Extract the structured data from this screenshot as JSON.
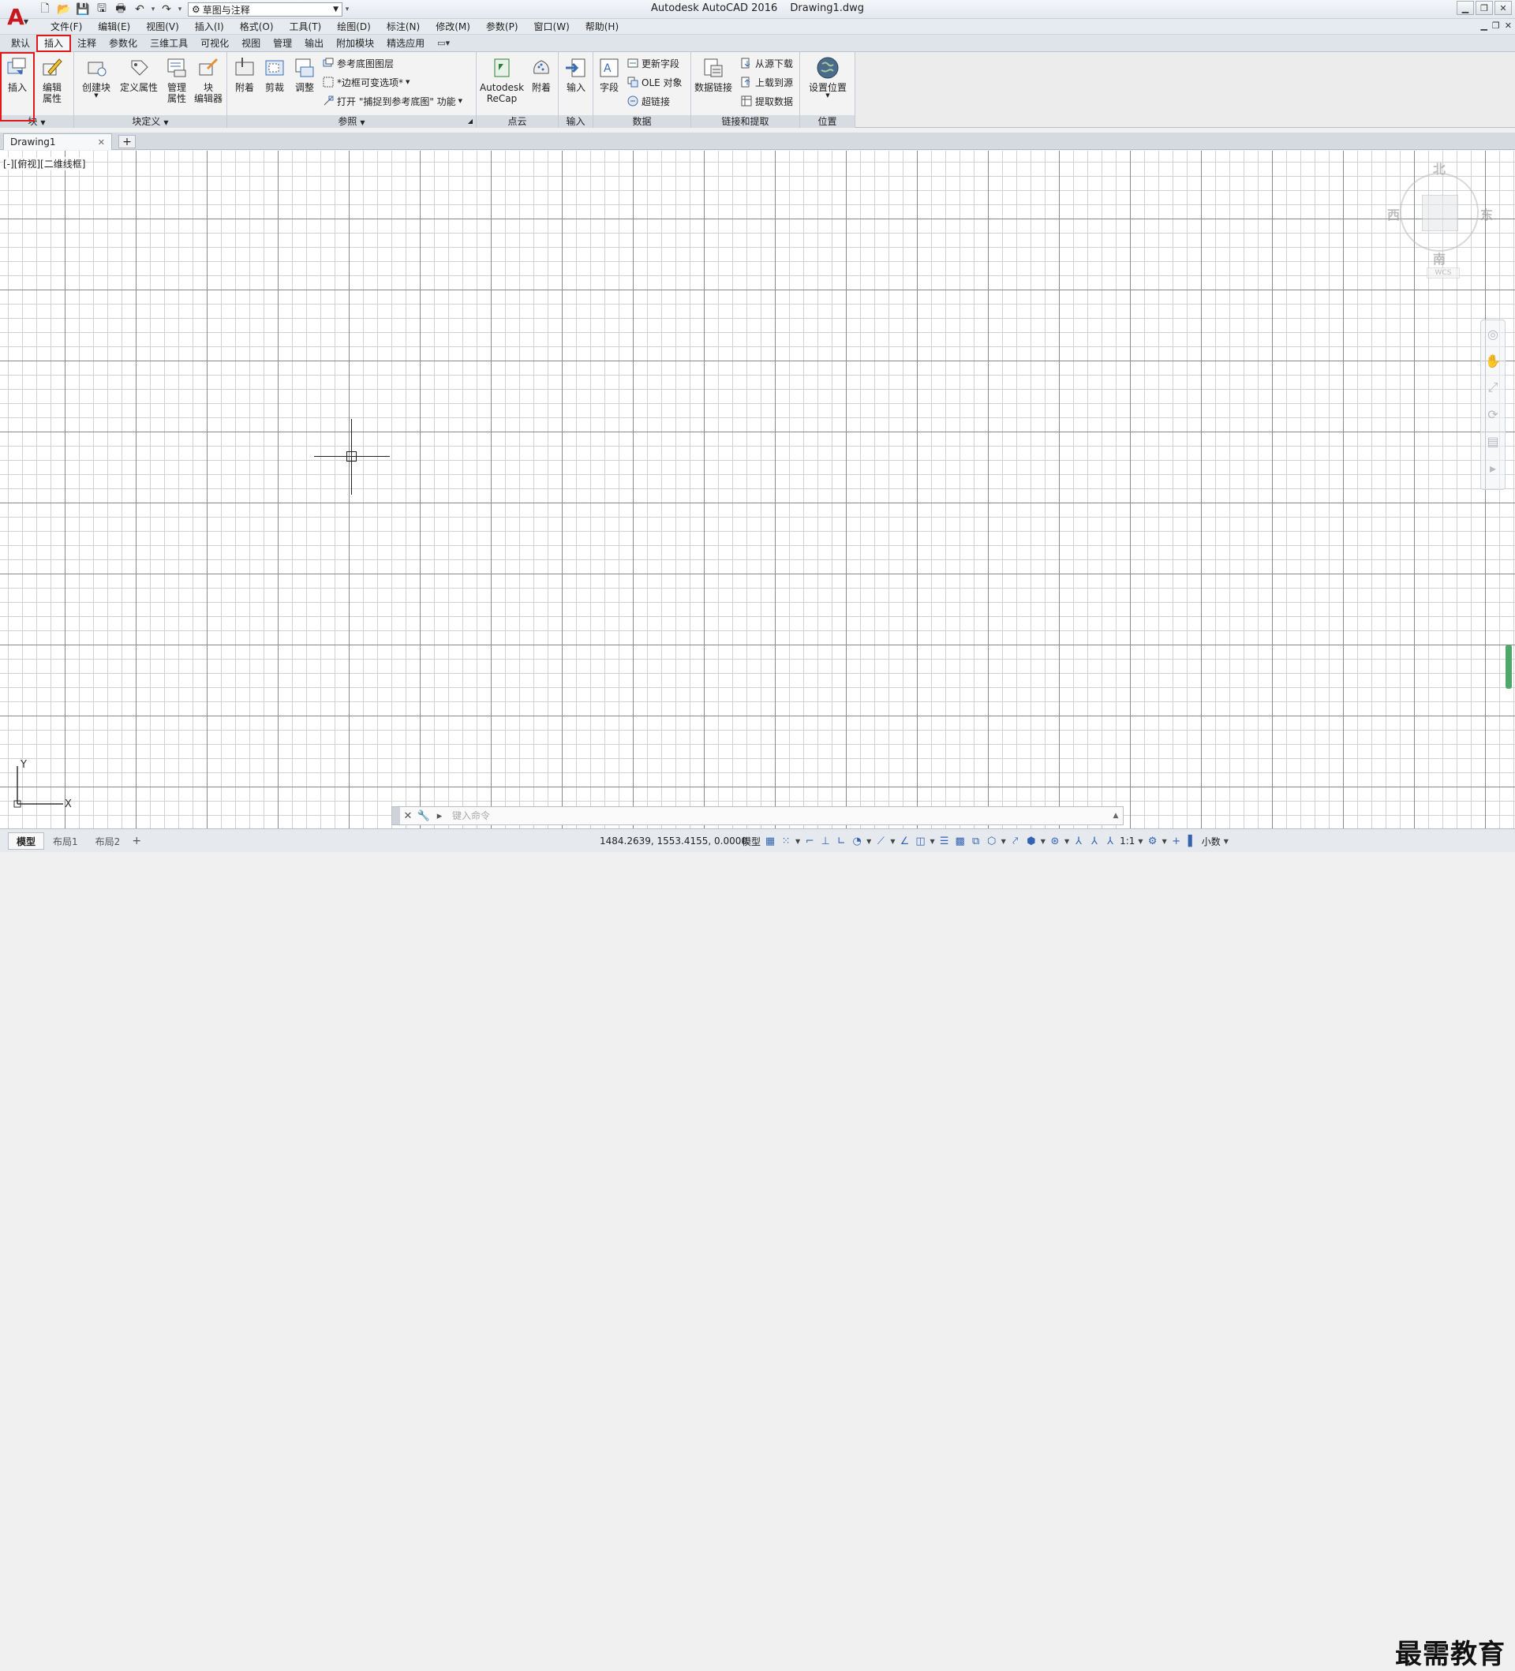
{
  "titlebar": {
    "app_title": "Autodesk AutoCAD 2016",
    "file_name": "Drawing1.dwg",
    "workspace": "草图与注释"
  },
  "menu": [
    "文件(F)",
    "编辑(E)",
    "视图(V)",
    "插入(I)",
    "格式(O)",
    "工具(T)",
    "绘图(D)",
    "标注(N)",
    "修改(M)",
    "参数(P)",
    "窗口(W)",
    "帮助(H)"
  ],
  "ribbon_tabs": [
    "默认",
    "插入",
    "注释",
    "参数化",
    "三维工具",
    "可视化",
    "视图",
    "管理",
    "输出",
    "附加模块",
    "精选应用"
  ],
  "active_tab": "插入",
  "panels": {
    "block": {
      "title": "块",
      "insert": "插入",
      "edit_attr_1": "编辑",
      "edit_attr_2": "属性"
    },
    "block_def": {
      "title": "块定义",
      "create": "创建块",
      "define_attr": "定义属性",
      "manage_1": "管理",
      "manage_2": "属性",
      "editor_1": "块",
      "editor_2": "编辑器"
    },
    "reference": {
      "title": "参照",
      "attach": "附着",
      "clip": "剪裁",
      "adjust": "调整",
      "underlay_layers": "参考底图图层",
      "frame_options": "*边框可变选项*",
      "snap_underlay": "打开 \"捕捉到参考底图\" 功能"
    },
    "point_cloud": {
      "title": "点云",
      "recap_1": "Autodesk",
      "recap_2": "ReCap",
      "attach": "附着"
    },
    "import": {
      "title": "输入",
      "import": "输入"
    },
    "data": {
      "title": "数据",
      "field": "字段",
      "update_fields": "更新字段",
      "ole_object": "OLE 对象",
      "hyperlink": "超链接"
    },
    "linking": {
      "title": "链接和提取",
      "data_link": "数据链接",
      "download_source": "从源下载",
      "upload_source": "上载到源",
      "extract_data": "提取数据"
    },
    "location": {
      "title": "位置",
      "set_location": "设置位置"
    }
  },
  "doc_tab": "Drawing1",
  "viewport_label": "[-][俯视][二维线框]",
  "viewcube": {
    "north": "北",
    "south": "南",
    "west": "西",
    "east": "东",
    "wcs": "WCS"
  },
  "ucs": {
    "x": "X",
    "y": "Y"
  },
  "command_line": {
    "placeholder": "键入命令"
  },
  "layout_tabs": [
    "模型",
    "布局1",
    "布局2"
  ],
  "status": {
    "coords": "1484.2639, 1553.4155, 0.0000",
    "model": "模型",
    "scale": "1:1",
    "units": "小数"
  },
  "watermark": "最需教育",
  "colors": {
    "highlight": "#e01818",
    "logo": "#c8181f",
    "status_icon": "#3364b2"
  }
}
